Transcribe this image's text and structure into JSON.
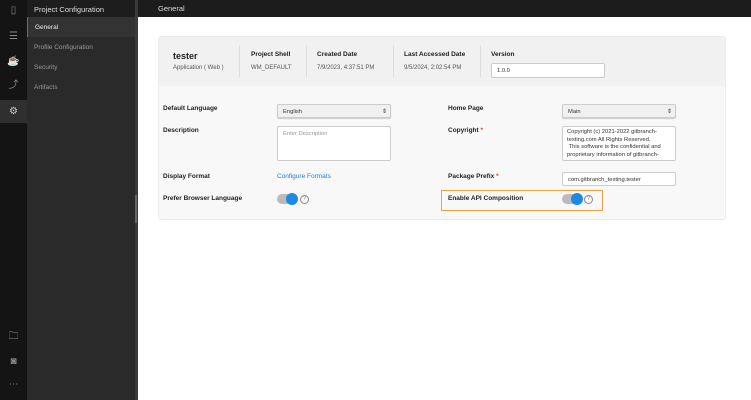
{
  "rail": {
    "icons": [
      "page-icon",
      "database-icon",
      "coffee-icon",
      "flow-icon",
      "gear-icon"
    ],
    "bottom_icons": [
      "folder-icon",
      "archive-icon",
      "more-icon"
    ]
  },
  "sidebar": {
    "title": "Project Configuration",
    "items": [
      {
        "label": "General",
        "active": true
      },
      {
        "label": "Profile Configuration"
      },
      {
        "label": "Security"
      },
      {
        "label": "Artifacts"
      }
    ]
  },
  "header": {
    "title": "General"
  },
  "meta": {
    "name": "tester",
    "type": "Application ( Web )",
    "shell_label": "Project Shell",
    "shell": "WM_DEFAULT",
    "created_label": "Created Date",
    "created": "7/9/2023, 4:37:51 PM",
    "accessed_label": "Last Accessed Date",
    "accessed": "9/5/2024, 2:02:54 PM",
    "version_label": "Version",
    "version": "1.0.0"
  },
  "form": {
    "default_language_label": "Default Language",
    "default_language": "English",
    "home_page_label": "Home Page",
    "home_page": "Main",
    "description_label": "Description",
    "description_placeholder": "Enter Description",
    "copyright_label": "Copyright",
    "copyright": "Copyright (c) 2021-2022 gitbranch-testing.com All Rights Reserved.\n This software is the confidential and proprietary information of gitbranch-",
    "display_format_label": "Display Format",
    "configure_formats": "Configure Formats",
    "package_prefix_label": "Package Prefix",
    "package_prefix": "com.gitbranch_testing.tester",
    "prefer_browser_label": "Prefer Browser Language",
    "prefer_browser_on": true,
    "api_composition_label": "Enable API Composition",
    "api_composition_on": true,
    "required_mark": "*",
    "help": "?"
  },
  "colors": {
    "accent": "#1e88e5",
    "highlight": "#f5a03c"
  }
}
